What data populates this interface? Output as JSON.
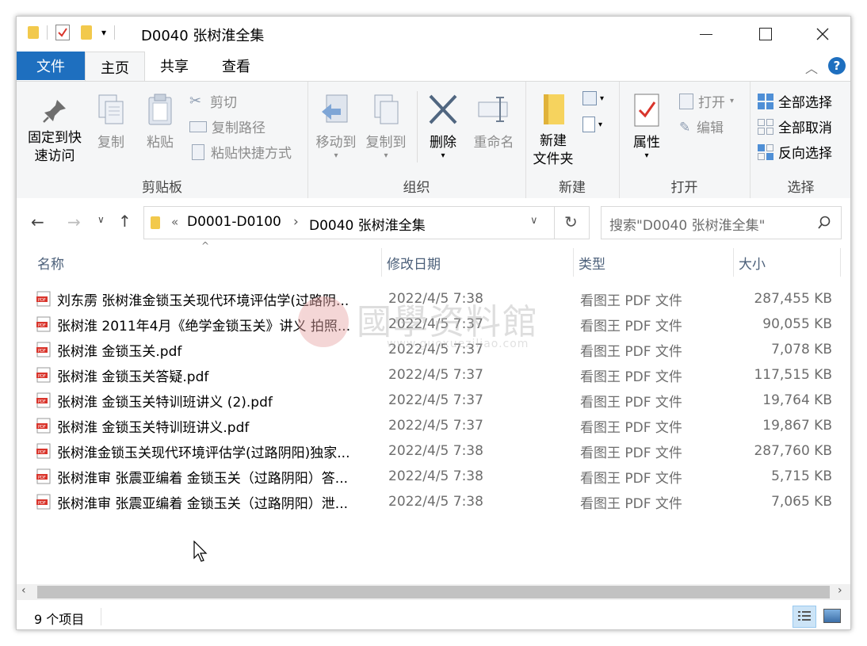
{
  "window": {
    "title": "D0040 张树淮全集"
  },
  "ribbon_tabs": {
    "file": "文件",
    "home": "主页",
    "share": "共享",
    "view": "查看"
  },
  "clipboard": {
    "group_label": "剪贴板",
    "pin_line1": "固定到快",
    "pin_line2": "速访问",
    "copy": "复制",
    "paste": "粘贴",
    "cut": "剪切",
    "copy_path": "复制路径",
    "paste_shortcut": "粘贴快捷方式"
  },
  "organize": {
    "group_label": "组织",
    "move_to": "移动到",
    "copy_to": "复制到",
    "delete": "删除",
    "rename": "重命名"
  },
  "new_group": {
    "group_label": "新建",
    "new_folder_line1": "新建",
    "new_folder_line2": "文件夹"
  },
  "open_group": {
    "group_label": "打开",
    "properties": "属性",
    "open": "打开",
    "edit": "编辑"
  },
  "select_group": {
    "group_label": "选择",
    "select_all": "全部选择",
    "select_none": "全部取消",
    "invert": "反向选择"
  },
  "address": {
    "overflow": "«",
    "crumb1": "D0001-D0100",
    "crumb2": "D0040 张树淮全集"
  },
  "search": {
    "placeholder": "搜索\"D0040 张树淮全集\""
  },
  "columns": {
    "name": "名称",
    "date": "修改日期",
    "type": "类型",
    "size": "大小"
  },
  "files": [
    {
      "name": "刘东雳 张树淮金锁玉关现代环境评估学(过路阴...",
      "date": "2022/4/5 7:38",
      "type": "看图王 PDF 文件",
      "size": "287,455 KB"
    },
    {
      "name": "张树淮 2011年4月《绝学金锁玉关》讲义 拍照...",
      "date": "2022/4/5 7:37",
      "type": "看图王 PDF 文件",
      "size": "90,055 KB"
    },
    {
      "name": "张树淮 金锁玉关.pdf",
      "date": "2022/4/5 7:37",
      "type": "看图王 PDF 文件",
      "size": "7,078 KB"
    },
    {
      "name": "张树淮 金锁玉关答疑.pdf",
      "date": "2022/4/5 7:37",
      "type": "看图王 PDF 文件",
      "size": "117,515 KB"
    },
    {
      "name": "张树淮 金锁玉关特训班讲义 (2).pdf",
      "date": "2022/4/5 7:37",
      "type": "看图王 PDF 文件",
      "size": "19,764 KB"
    },
    {
      "name": "张树淮 金锁玉关特训班讲义.pdf",
      "date": "2022/4/5 7:37",
      "type": "看图王 PDF 文件",
      "size": "19,867 KB"
    },
    {
      "name": "张树淮金锁玉关现代环境评估学(过路阴阳)独家...",
      "date": "2022/4/5 7:38",
      "type": "看图王 PDF 文件",
      "size": "287,760 KB"
    },
    {
      "name": "张树淮审 张震亚编着 金锁玉关（过路阴阳）答...",
      "date": "2022/4/5 7:38",
      "type": "看图王 PDF 文件",
      "size": "5,715 KB"
    },
    {
      "name": "张树淮审 张震亚编着 金锁玉关（过路阴阳）泄...",
      "date": "2022/4/5 7:38",
      "type": "看图王 PDF 文件",
      "size": "7,065 KB"
    }
  ],
  "status": {
    "count": "9 个项目"
  },
  "watermark": {
    "text": "國學资料館",
    "url": "www.guoxueziliao.com"
  },
  "colors": {
    "accent": "#1e6fbf",
    "header_text": "#4c607a",
    "disabled": "#8c8c8c"
  }
}
